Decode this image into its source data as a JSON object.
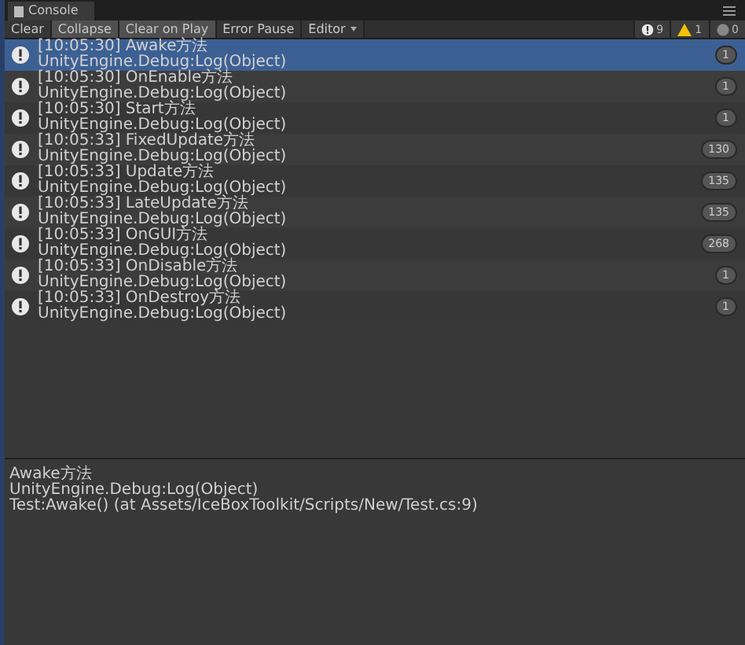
{
  "window": {
    "title": "Console"
  },
  "toolbar": {
    "buttons": [
      {
        "label": "Clear",
        "selected": false
      },
      {
        "label": "Collapse",
        "selected": true
      },
      {
        "label": "Clear on Play",
        "selected": true
      },
      {
        "label": "Error Pause",
        "selected": false
      }
    ],
    "dropdown": {
      "label": "Editor"
    },
    "counters": [
      {
        "kind": "info",
        "count": "9"
      },
      {
        "kind": "warning",
        "count": "1"
      },
      {
        "kind": "error",
        "count": "0"
      }
    ]
  },
  "logs": [
    {
      "message": "[10:05:30] Awake方法",
      "source": "UnityEngine.Debug:Log(Object)",
      "count": "1",
      "selected": true
    },
    {
      "message": "[10:05:30] OnEnable方法",
      "source": "UnityEngine.Debug:Log(Object)",
      "count": "1",
      "selected": false
    },
    {
      "message": "[10:05:30] Start方法",
      "source": "UnityEngine.Debug:Log(Object)",
      "count": "1",
      "selected": false
    },
    {
      "message": "[10:05:33] FixedUpdate方法",
      "source": "UnityEngine.Debug:Log(Object)",
      "count": "130",
      "selected": false
    },
    {
      "message": "[10:05:33] Update方法",
      "source": "UnityEngine.Debug:Log(Object)",
      "count": "135",
      "selected": false
    },
    {
      "message": "[10:05:33] LateUpdate方法",
      "source": "UnityEngine.Debug:Log(Object)",
      "count": "135",
      "selected": false
    },
    {
      "message": "[10:05:33] OnGUI方法",
      "source": "UnityEngine.Debug:Log(Object)",
      "count": "268",
      "selected": false
    },
    {
      "message": "[10:05:33] OnDisable方法",
      "source": "UnityEngine.Debug:Log(Object)",
      "count": "1",
      "selected": false
    },
    {
      "message": "[10:05:33] OnDestroy方法",
      "source": "UnityEngine.Debug:Log(Object)",
      "count": "1",
      "selected": false
    }
  ],
  "detail": {
    "lines": [
      "Awake方法",
      "UnityEngine.Debug:Log(Object)",
      "Test:Awake() (at Assets/IceBoxToolkit/Scripts/New/Test.cs:9)"
    ]
  }
}
